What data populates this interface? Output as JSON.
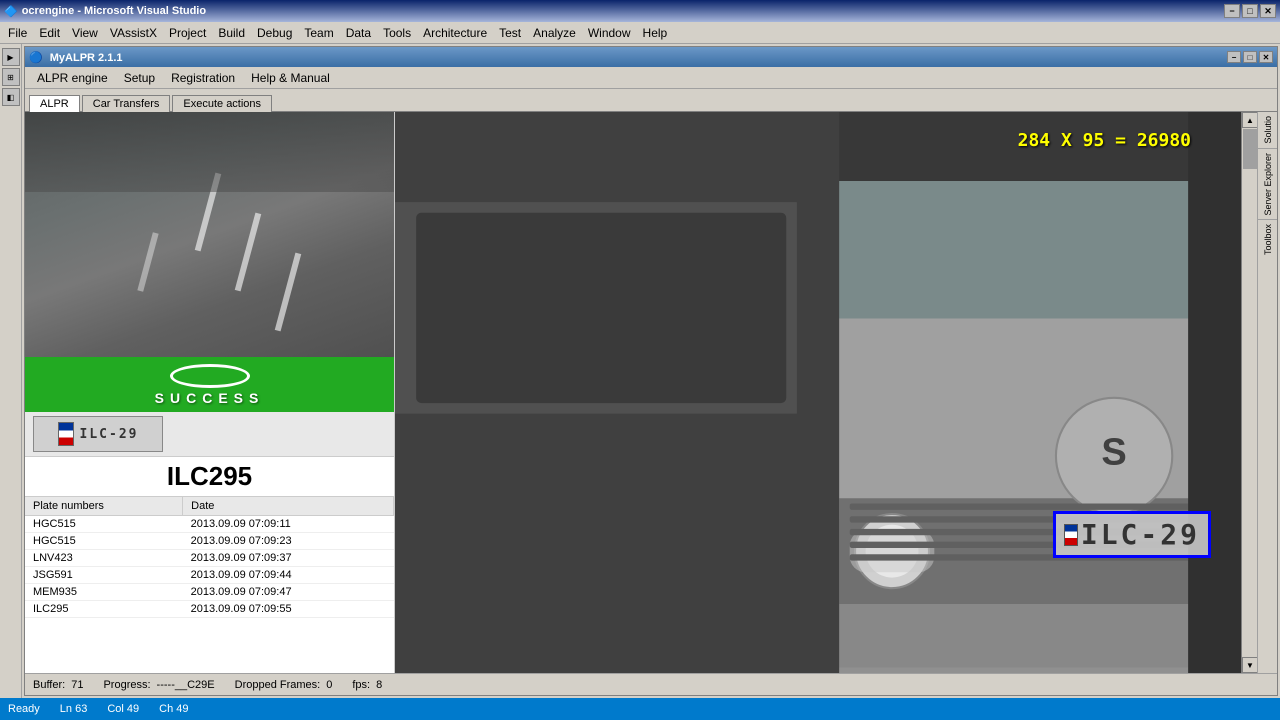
{
  "titlebar": {
    "title": "ocrengine - Microsoft Visual Studio",
    "min": "−",
    "max": "□",
    "close": "✕"
  },
  "vs_menu": {
    "items": [
      "File",
      "Edit",
      "View",
      "VAssistX",
      "Project",
      "Build",
      "Debug",
      "Team",
      "Data",
      "Tools",
      "Architecture",
      "Test",
      "Analyze",
      "Window",
      "Help"
    ]
  },
  "myalpr": {
    "title": "MyALPR 2.1.1",
    "min": "−",
    "max": "□",
    "close": "✕",
    "menu_items": [
      "ALPR engine",
      "Setup",
      "Registration",
      "Help & Manual"
    ],
    "tabs": [
      "ALPR",
      "Car Transfers",
      "Execute actions"
    ]
  },
  "success": {
    "text": "SUCCESS"
  },
  "plate": {
    "number": "ILC295",
    "image_text": "ILC-29",
    "overlay_text": "ILC-29"
  },
  "table": {
    "headers": [
      "Plate numbers",
      "Date"
    ],
    "rows": [
      {
        "plate": "HGC515",
        "date": "2013.09.09 07:09:11"
      },
      {
        "plate": "HGC515",
        "date": "2013.09.09 07:09:23"
      },
      {
        "plate": "LNV423",
        "date": "2013.09.09 07:09:37"
      },
      {
        "plate": "JSG591",
        "date": "2013.09.09 07:09:44"
      },
      {
        "plate": "MEM935",
        "date": "2013.09.09 07:09:47"
      },
      {
        "plate": "ILC295",
        "date": "2013.09.09 07:09:55"
      }
    ]
  },
  "dim_text": "284 X 95 = 26980",
  "statusbar": {
    "buffer_label": "Buffer:",
    "buffer_val": "71",
    "progress_label": "Progress:",
    "progress_val": "-----__C29E",
    "dropped_label": "Dropped Frames:",
    "dropped_val": "0",
    "fps_label": "fps:",
    "fps_val": "8"
  },
  "vs_statusbar": {
    "status": "Ready",
    "ln": "Ln 63",
    "col": "Col 49",
    "ch": "Ch 49"
  },
  "right_labels": {
    "solution": "Solutio",
    "server": "Server Explorer",
    "toolbox": "Toolbox"
  }
}
